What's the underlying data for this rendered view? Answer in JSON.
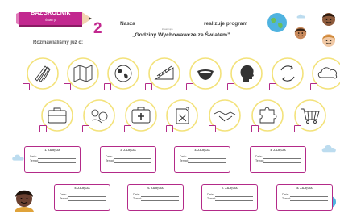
{
  "header": {
    "pencil_title": "BAZGROLNIK",
    "pencil_subtitle": "Świat i ja",
    "number": "2",
    "line1_start": "Nasza",
    "line1_end": "realizuje program",
    "line_hint": "klasa/grupa",
    "program_title": "„Godziny Wychowawcze ze Światem”."
  },
  "section_label": "Rozmawialiśmy już o:",
  "icons": [
    {
      "name": "pencils-icon"
    },
    {
      "name": "map-icon"
    },
    {
      "name": "globe-icon"
    },
    {
      "name": "ruler-triangle-icon"
    },
    {
      "name": "mouth-icon"
    },
    {
      "name": "head-silhouette-icon"
    },
    {
      "name": "recycle-arrows-icon"
    },
    {
      "name": "cloud-icon"
    },
    {
      "name": "briefcase-icon"
    },
    {
      "name": "scribble-icon"
    },
    {
      "name": "first-aid-kit-icon"
    },
    {
      "name": "fuel-can-icon"
    },
    {
      "name": "handshake-icon"
    },
    {
      "name": "puzzle-icon"
    },
    {
      "name": "shopping-cart-icon"
    }
  ],
  "sessions": [
    {
      "title": "1. ZAJĘCIA",
      "date_label": "Data:",
      "topic_label": "Temat:"
    },
    {
      "title": "2. ZAJĘCIA",
      "date_label": "Data:",
      "topic_label": "Temat:"
    },
    {
      "title": "3. ZAJĘCIA",
      "date_label": "Data:",
      "topic_label": "Temat:"
    },
    {
      "title": "4. ZAJĘCIA",
      "date_label": "Data:",
      "topic_label": "Temat:"
    },
    {
      "title": "5. ZAJĘCIA",
      "date_label": "Data:",
      "topic_label": "Temat:"
    },
    {
      "title": "6. ZAJĘCIA",
      "date_label": "Data:",
      "topic_label": "Temat:"
    },
    {
      "title": "7. ZAJĘCIA",
      "date_label": "Data:",
      "topic_label": "Temat:"
    },
    {
      "title": "8. ZAJĘCIA",
      "date_label": "Data:",
      "topic_label": "Temat:"
    }
  ],
  "colors": {
    "accent": "#c2288f",
    "tile_ring": "#f3e27a",
    "card_border": "#b32a88"
  }
}
